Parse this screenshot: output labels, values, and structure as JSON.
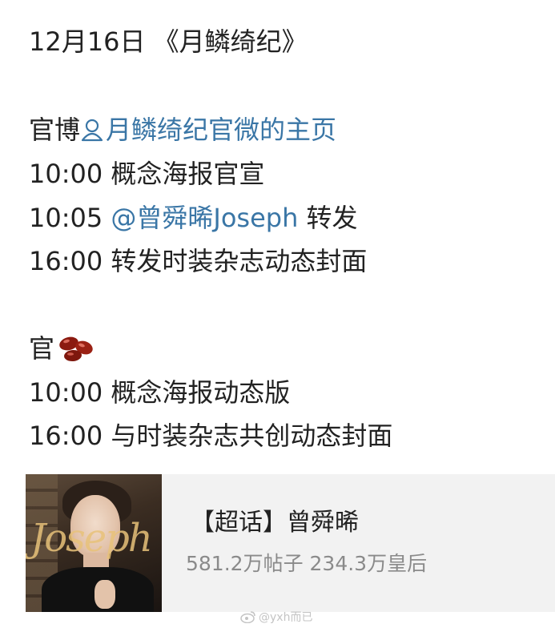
{
  "post": {
    "header": "12月16日 《月鳞绮纪》",
    "section1_label": "官博",
    "section1_link": "月鳞绮纪官微的主页",
    "section1_items": [
      {
        "time": "10:00",
        "text": " 概念海报官宣",
        "mention": ""
      },
      {
        "time": "10:05",
        "text": " 转发",
        "mention": " @曾舜晞Joseph"
      },
      {
        "time": "16:00",
        "text": " 转发时装杂志动态封面",
        "mention": ""
      }
    ],
    "section2_label": "官",
    "section2_icon": "red-bean-emoji-icon",
    "section2_items": [
      {
        "time": "10:00",
        "text": " 概念海报动态版"
      },
      {
        "time": "16:00",
        "text": " 与时装杂志共创动态封面"
      }
    ]
  },
  "card": {
    "title": "【超话】曾舜晞",
    "stats": "581.2万帖子 234.3万皇后",
    "thumb_logo": "Joseph"
  },
  "watermark": {
    "text": "@yxh而已",
    "icon": "weibo-icon"
  },
  "colors": {
    "link": "#3a76a6",
    "text": "#222222",
    "muted": "#8a8a8a",
    "card_bg": "#f2f2f2"
  }
}
